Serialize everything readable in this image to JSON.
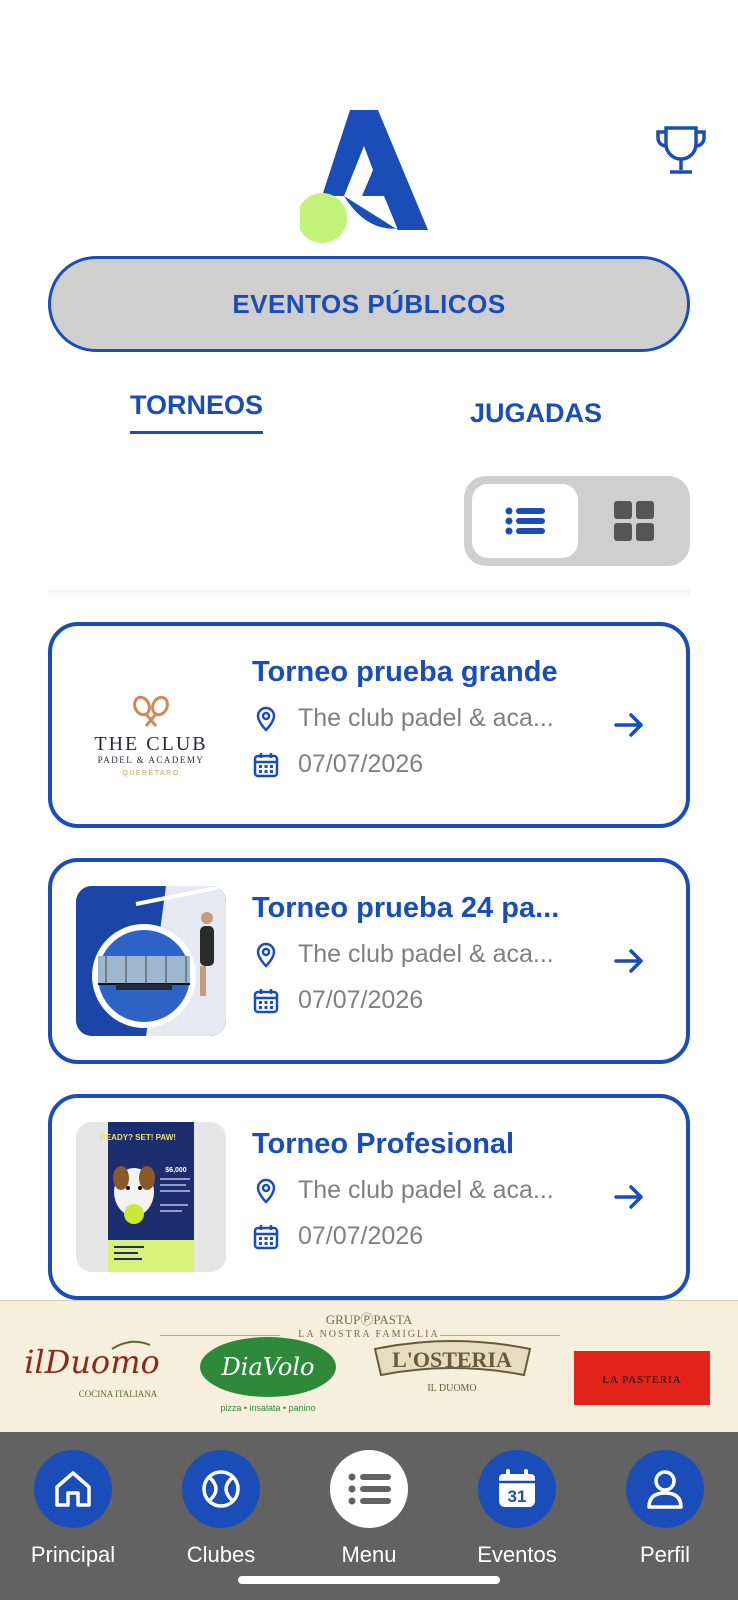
{
  "header": {
    "public_events_label": "EVENTOS PÚBLICOS"
  },
  "tabs": [
    {
      "label": "TORNEOS",
      "active": true
    },
    {
      "label": "JUGADAS",
      "active": false
    }
  ],
  "view_toggle": {
    "selected": "list",
    "options": [
      "list-icon",
      "grid-icon"
    ]
  },
  "events": [
    {
      "title": "Torneo prueba grande",
      "location": "The club padel & aca...",
      "date": "07/07/2026",
      "thumb": {
        "brand": "THE CLUB",
        "tagline": "PADEL & ACADEMY",
        "city": "QUERÉTARO"
      }
    },
    {
      "title": "Torneo prueba 24 pa...",
      "location": "The club padel & aca...",
      "date": "07/07/2026",
      "thumb": {
        "kind": "photo"
      }
    },
    {
      "title": "Torneo Profesional",
      "location": "The club padel & aca...",
      "date": "07/07/2026",
      "thumb": {
        "kind": "poster",
        "headline": "READY? SET! PAW!",
        "price": "$6,000"
      }
    }
  ],
  "sponsor": {
    "group": "GRUPⓅPASTA",
    "tagline": "LA NOSTRA FAMIGLIA",
    "brands": [
      {
        "name": "ilDuomo",
        "sub": "COCINA ITALIANA"
      },
      {
        "name": "DiaVolo",
        "sub": "pizza • insalata • panino"
      },
      {
        "name": "L'OSTERIA",
        "sub": "IL DUOMO"
      },
      {
        "name": "LA PASTERIA",
        "sub": ""
      }
    ]
  },
  "bottom_nav": [
    {
      "label": "Principal",
      "icon": "home-icon"
    },
    {
      "label": "Clubes",
      "icon": "ball-icon"
    },
    {
      "label": "Menu",
      "icon": "menu-icon"
    },
    {
      "label": "Eventos",
      "icon": "calendar-icon",
      "day": "31"
    },
    {
      "label": "Perfil",
      "icon": "user-icon"
    }
  ],
  "colors": {
    "primary": "#1a4db8",
    "accent_ball": "#c3f37a",
    "muted_text": "#808080",
    "nav_bg": "#626262",
    "pill_bg": "#cfcfcf"
  }
}
